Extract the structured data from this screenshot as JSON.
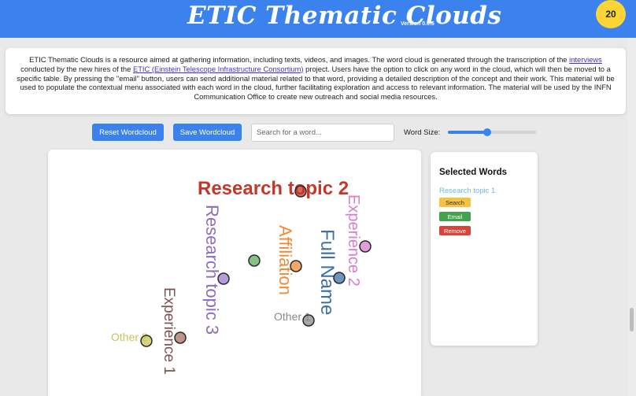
{
  "header": {
    "title": "ETIC Thematic Clouds",
    "version": "Version 0.0.5",
    "counter": "20",
    "bg_color": "#3b82ee",
    "counter_color": "#fcd535"
  },
  "intro": {
    "p1": "ETIC Thematic Clouds is a resource aimed at gathering information, including texts, videos, and images. The word cloud is generated through the transcription of the ",
    "link1": "interviews",
    "p2": " conducted by the new hires of the ",
    "link2": "ETIC (Einstein Telescope Infrastructure Consortium)",
    "p3": " project. Users have the option to click on any word in the cloud, which will then be moved to a specific table. By pressing the \"email\" button, users can send additional material related to that word, providing a detailed description of the concept and their work. This material will be used to populate the contextual menu associated with each word in the cloud, further facilitating exploration and access to relevant information. The material will be used by the INFN Communication Office to create new outreach and social media resources."
  },
  "toolbar": {
    "reset_label": "Reset Wordcloud",
    "save_label": "Save Wordcloud",
    "search_placeholder": "Search for a word...",
    "search_value": "",
    "size_label": "Word Size:",
    "size_fraction": 0.45
  },
  "wordcloud": {
    "words": [
      {
        "text": "Research topic 2",
        "color": "#c0392b",
        "orientation": "horizontal",
        "bold": true
      },
      {
        "text": "Research topic 3",
        "color": "#8e6bbf",
        "orientation": "vertical"
      },
      {
        "text": "Experience 2",
        "color": "#d77fc9",
        "orientation": "vertical"
      },
      {
        "text": "Affiliation",
        "color": "#f08a36",
        "orientation": "vertical"
      },
      {
        "text": "Full Name",
        "color": "#3d6fa8",
        "orientation": "vertical"
      },
      {
        "text": "Experience 1",
        "color": "#7a5550",
        "orientation": "vertical"
      },
      {
        "text": "Other 1",
        "color": "#8a8a8a",
        "orientation": "horizontal"
      },
      {
        "text": "Other 2",
        "color": "#c9c456",
        "orientation": "horizontal"
      }
    ],
    "dot_colors": [
      "#c0392b",
      "#d77fc9",
      "#5aad5a",
      "#f08a36",
      "#9b7ccc",
      "#3d6fa8",
      "#8a8a8a",
      "#c9c456",
      "#a86f63"
    ]
  },
  "panel": {
    "title": "Selected Words",
    "selected": [
      {
        "word": "Research topic 1",
        "color": "#6bbfdc",
        "search_label": "Search",
        "email_label": "Email",
        "remove_label": "Remove"
      }
    ]
  }
}
